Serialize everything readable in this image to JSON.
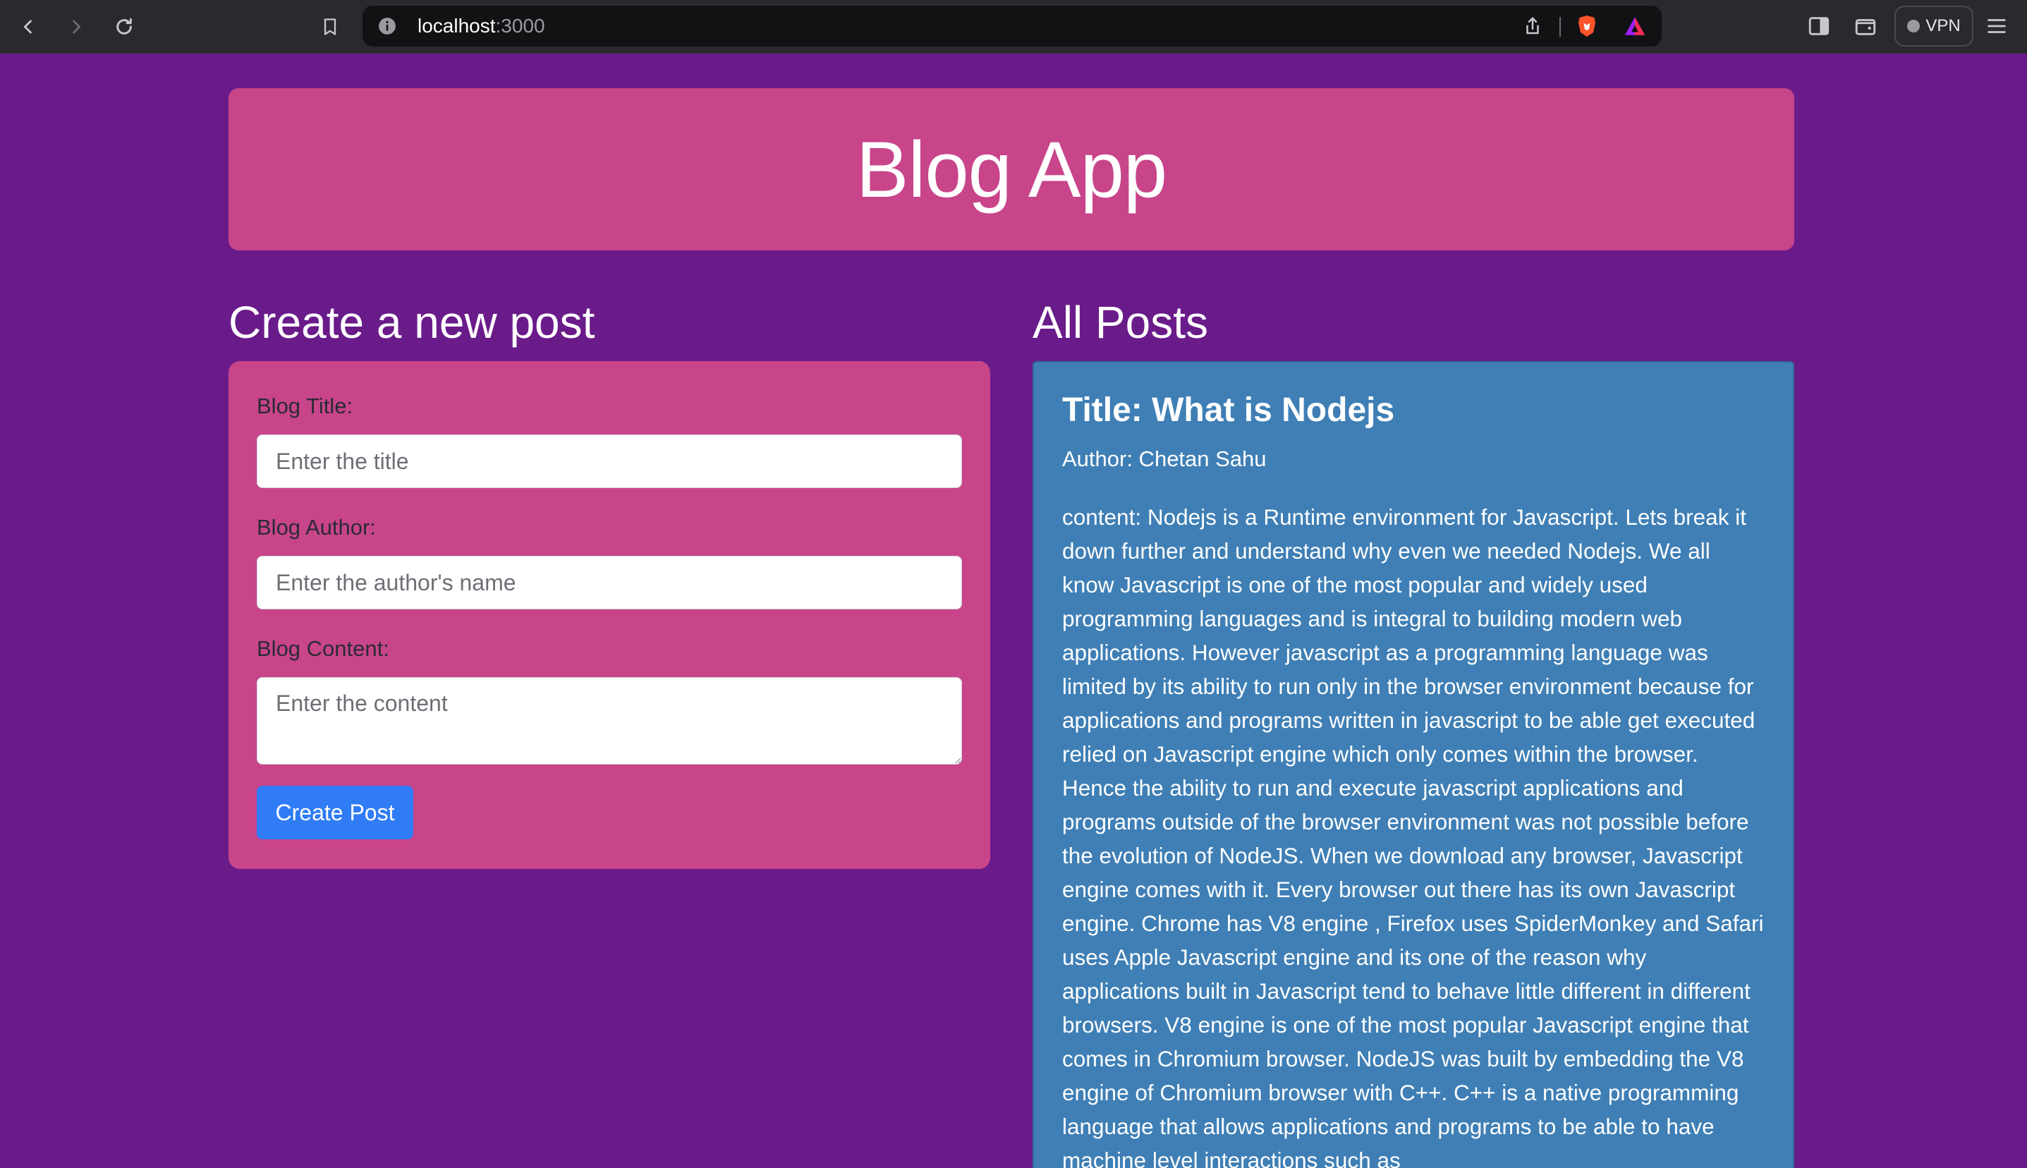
{
  "browser": {
    "url_host": "localhost",
    "url_port": ":3000",
    "vpn_label": "VPN"
  },
  "header": {
    "title": "Blog App"
  },
  "create_section": {
    "heading": "Create a new post",
    "title_label": "Blog Title:",
    "title_placeholder": "Enter the title",
    "author_label": "Blog Author:",
    "author_placeholder": "Enter the author's name",
    "content_label": "Blog Content:",
    "content_placeholder": "Enter the content",
    "submit_label": "Create Post"
  },
  "posts_section": {
    "heading": "All Posts",
    "posts": [
      {
        "title": "Title: What is Nodejs",
        "author": "Author: Chetan Sahu",
        "content": "content: Nodejs is a Runtime environment for Javascript. Lets break it down further and understand why even we needed Nodejs. We all know Javascript is one of the most popular and widely used programming languages and is integral to building modern web applications. However javascript as a programming language was limited by its ability to run only in the browser environment because for applications and programs written in javascript to be able get executed relied on Javascript engine which only comes within the browser. Hence the ability to run and execute javascript applications and programs outside of the browser environment was not possible before the evolution of NodeJS. When we download any browser, Javascript engine comes with it. Every browser out there has its own Javascript engine. Chrome has V8 engine , Firefox uses SpiderMonkey and Safari uses Apple Javascript engine and its one of the reason why applications built in Javascript tend to behave little different in different browsers. V8 engine is one of the most popular Javascript engine that comes in Chromium browser. NodeJS was built by embedding the V8 engine of Chromium browser with C++. C++ is a native programming language that allows applications and programs to be able to have machine level interactions such as"
      }
    ]
  },
  "colors": {
    "page_bg": "#6a1b8a",
    "card_pink": "#c8458a",
    "post_blue": "#3f7fb5",
    "button_blue": "#2f7cf6"
  }
}
